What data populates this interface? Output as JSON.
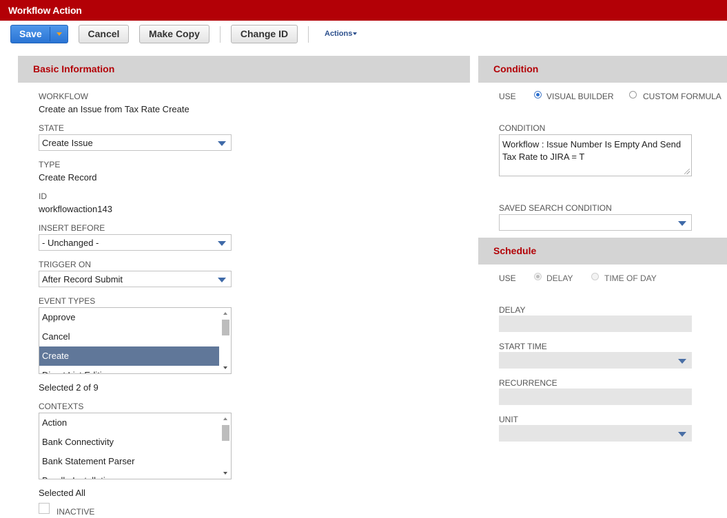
{
  "window": {
    "title": "Workflow Action"
  },
  "toolbar": {
    "save_label": "Save",
    "cancel_label": "Cancel",
    "make_copy_label": "Make Copy",
    "change_id_label": "Change ID",
    "actions_label": "Actions"
  },
  "basic": {
    "header": "Basic Information",
    "workflow_label": "WORKFLOW",
    "workflow_value": "Create an Issue from Tax Rate Create",
    "state_label": "STATE",
    "state_value": "Create Issue",
    "type_label": "TYPE",
    "type_value": "Create Record",
    "id_label": "ID",
    "id_value": "workflowaction143",
    "insert_before_label": "INSERT BEFORE",
    "insert_before_value": "- Unchanged -",
    "trigger_on_label": "TRIGGER ON",
    "trigger_on_value": "After Record Submit",
    "event_types_label": "EVENT TYPES",
    "event_types": [
      "Approve",
      "Cancel",
      "Create",
      "Direct List Editing"
    ],
    "event_types_selected_index": 2,
    "event_types_count": "Selected 2 of 9",
    "contexts_label": "CONTEXTS",
    "contexts": [
      "Action",
      "Bank Connectivity",
      "Bank Statement Parser",
      "Bundle Installation"
    ],
    "contexts_count": "Selected All",
    "inactive_label": "INACTIVE"
  },
  "condition": {
    "header": "Condition",
    "use_label": "USE",
    "visual_builder_label": "VISUAL BUILDER",
    "custom_formula_label": "CUSTOM FORMULA",
    "condition_label": "CONDITION",
    "condition_value": "Workflow : Issue Number Is Empty And Send Tax Rate to JIRA = T",
    "saved_search_label": "SAVED SEARCH CONDITION",
    "saved_search_value": ""
  },
  "schedule": {
    "header": "Schedule",
    "use_label": "USE",
    "delay_radio_label": "DELAY",
    "time_of_day_label": "TIME OF DAY",
    "delay_label": "DELAY",
    "start_time_label": "START TIME",
    "recurrence_label": "RECURRENCE",
    "unit_label": "UNIT"
  },
  "colors": {
    "brand_red": "#b30006",
    "save_blue": "#2a74d4",
    "selection": "#607799",
    "section_gray": "#d4d4d4"
  }
}
